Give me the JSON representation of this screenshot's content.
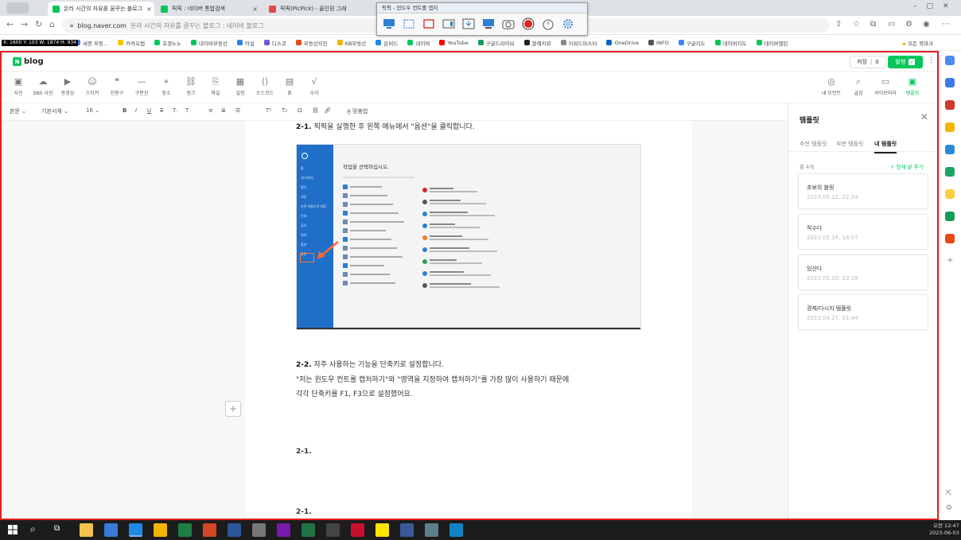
{
  "browser": {
    "tabs": [
      {
        "title": "온라 시간의 자유를 꿈꾸는 블로그",
        "active": true,
        "favicon_color": "#03c75a"
      },
      {
        "title": "픽픽 : 네이버 통합검색",
        "active": false,
        "favicon_color": "#03c75a"
      },
      {
        "title": "픽픽(PicPick) - 올인원 그래",
        "active": false,
        "favicon_color": "#e0464b"
      }
    ],
    "url_host": "blog.naver.com",
    "url_rest": "온라 시간의 자유를 꿈꾸는 블로그 : 네이버 블로그",
    "bookmarks": [
      "세종 부동...",
      "카카오맵",
      "호갱노노",
      "네이버부동산",
      "아실",
      "디스코",
      "부동산지인",
      "KB부동산",
      "온비드",
      "네이버",
      "YouTube",
      "구글드라이브",
      "블랙키위",
      "키워드마스터",
      "OneDrive",
      "INFO",
      "구글지도",
      "네이버지도",
      "네이버캘린"
    ],
    "bookmark_folder": "모든 북마크",
    "coords_readout": "X: 1600 Y: 103 W: 1874 H: 934"
  },
  "capture_toolbar": {
    "title": "픽픽 - 윈도우 컨트롤 캡처",
    "icons": [
      "monitor-icon",
      "window-icon",
      "region-icon",
      "scroll-capture-icon",
      "download-icon",
      "monitor-icon",
      "camera-icon",
      "record-icon",
      "timer-icon",
      "settings-icon"
    ]
  },
  "editor": {
    "logo": "blog",
    "save_label": "저장",
    "save_count": "0",
    "publish_label": "발행",
    "tools": [
      "사진",
      "SNS 사진",
      "동영상",
      "스티커",
      "인용구",
      "구분선",
      "장소",
      "링크",
      "파일",
      "일정",
      "소스코드",
      "표",
      "수식"
    ],
    "right_tools": [
      "내 모먼트",
      "글감",
      "라이브러리",
      "템플릿"
    ],
    "format": {
      "style": "본문",
      "font": "기본서체",
      "size": "16",
      "spell": "맞춤법"
    }
  },
  "document": {
    "p1_num": "2-1.",
    "p1_text": "픽픽을 실행한 후 왼쪽 메뉴에서 \"옵션\"을 클릭합니다.",
    "p2_num": "2-2.",
    "p2_text": "자주 사용하는 기능을 단축키로 설정합니다.",
    "p3": "\"저는 윈도우 컨트롤 캡처하기\"와 \"영역을 지정하여 캡처하기\"를 가장 많이 사용하기 때문에",
    "p4": "각각 단축키를 F1, F3으로 설정했어요.",
    "p5": "2-1.",
    "p6": "2-1.",
    "embedded_screenshot": {
      "heading": "작업을 선택하십시오.",
      "left_menu": [
        "홈",
        "새 이미지",
        "열기",
        "저장",
        "다른 이름으로 저장",
        "인쇄",
        "공유",
        "정보",
        "옵션",
        "종료"
      ]
    }
  },
  "template_panel": {
    "title": "템플릿",
    "tabs": [
      "추천 템플릿",
      "부분 템플릿",
      "내 템플릿"
    ],
    "active_tab": 2,
    "count": "총 4개",
    "add_label": "+ 현재 글 추가",
    "cards": [
      {
        "title": "초보의 블링",
        "date": "2023.05.22. 22:24"
      },
      {
        "title": "작수다",
        "date": "2023.05.16. 18:07"
      },
      {
        "title": "임산다",
        "date": "2023.05.10. 23:28"
      },
      {
        "title": "경제/다시지 템플릿",
        "date": "2023.04.27. 01:44"
      }
    ]
  },
  "taskbar": {
    "time": "오전 12:47",
    "date": "2023-06-03"
  },
  "colors": {
    "brand": "#03c75a",
    "frame": "#e32020",
    "taskbar": "#1c1c1c"
  }
}
